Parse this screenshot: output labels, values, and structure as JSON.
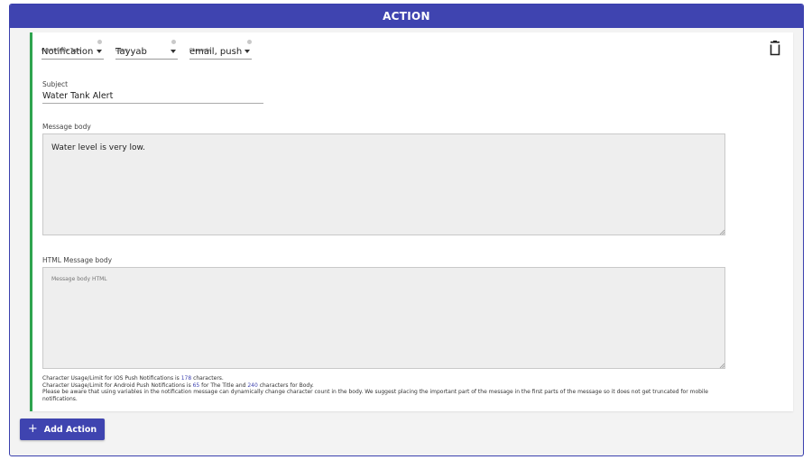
{
  "header": {
    "title": "ACTION"
  },
  "action": {
    "controllable_type": {
      "label": "Controllable Type",
      "value": "Notification"
    },
    "users": {
      "label": "Users",
      "value": "Tayyab"
    },
    "channels": {
      "label": "Channels",
      "value": "email, push"
    },
    "subject": {
      "label": "Subject",
      "value": "Water Tank Alert"
    },
    "message_body": {
      "label": "Message body",
      "value": "Water level is very low."
    },
    "html_message_body": {
      "label": "HTML Message body",
      "placeholder": "Message body HTML",
      "value": ""
    },
    "notes": {
      "ios_prefix": "Character Usage/Limit for IOS Push Notifications is ",
      "ios_limit": "178",
      "ios_suffix": " characters.",
      "android_prefix": "Character Usage/Limit for Android Push Notifications is ",
      "android_title_limit": "65",
      "android_mid": " for The Title and ",
      "android_body_limit": "240",
      "android_suffix": " characters for Body.",
      "variables_warning": "Please be aware that using variables in the notification message can dynamically change character count in the body. We suggest placing the important part of the message in the first parts of the message so it does not get truncated for mobile notifications."
    }
  },
  "add_action": {
    "label": "Add Action",
    "icon": "plus-icon"
  },
  "colors": {
    "primary": "#3f44b0",
    "accent_border": "#2ea44f"
  }
}
